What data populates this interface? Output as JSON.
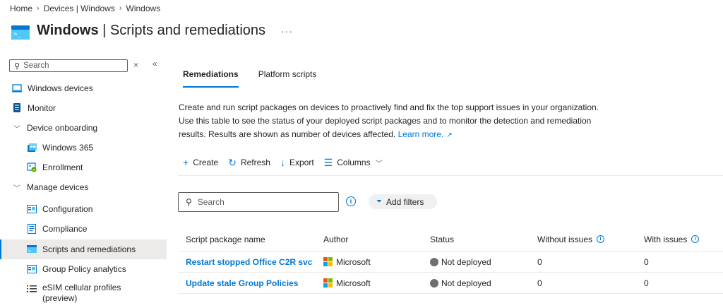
{
  "breadcrumb": [
    "Home",
    "Devices | Windows",
    "Windows"
  ],
  "header": {
    "title_bold": "Windows",
    "title_rest": " | Scripts and remediations",
    "more": "···"
  },
  "sidebar": {
    "search_placeholder": "Search",
    "close_glyph": "×",
    "collapse_glyph": "«",
    "items": [
      {
        "label": "Windows devices",
        "icon": "laptop-icon"
      },
      {
        "label": "Monitor",
        "icon": "monitor-icon"
      },
      {
        "label": "Device onboarding",
        "icon": "chevron-down-icon"
      },
      {
        "label": "Windows 365",
        "icon": "windows365-icon"
      },
      {
        "label": "Enrollment",
        "icon": "enrollment-icon"
      },
      {
        "label": "Manage devices",
        "icon": "chevron-down-icon"
      },
      {
        "label": "Configuration",
        "icon": "configuration-icon"
      },
      {
        "label": "Compliance",
        "icon": "compliance-icon"
      },
      {
        "label": "Scripts and remediations",
        "icon": "scripts-icon",
        "selected": true
      },
      {
        "label": "Group Policy analytics",
        "icon": "group-policy-icon"
      },
      {
        "label": "eSIM cellular profiles (preview)",
        "icon": "esim-icon"
      }
    ]
  },
  "tabs": [
    {
      "label": "Remediations",
      "active": true
    },
    {
      "label": "Platform scripts",
      "active": false
    }
  ],
  "description": {
    "text": "Create and run script packages on devices to proactively find and fix the top support issues in your organization. Use this table to see the status of your deployed script packages and to monitor the detection and remediation results. Results are shown as number of devices affected. ",
    "link": "Learn more."
  },
  "toolbar": {
    "create": "Create",
    "refresh": "Refresh",
    "export": "Export",
    "columns": "Columns"
  },
  "search": {
    "placeholder": "Search"
  },
  "filters": {
    "add_label": "Add filters"
  },
  "table": {
    "columns": [
      "Script package name",
      "Author",
      "Status",
      "Without issues",
      "With issues"
    ],
    "rows": [
      {
        "name": "Restart stopped Office C2R svc",
        "author": "Microsoft",
        "status": "Not deployed",
        "without": "0",
        "with": "0"
      },
      {
        "name": "Update stale Group Policies",
        "author": "Microsoft",
        "status": "Not deployed",
        "without": "0",
        "with": "0"
      }
    ]
  },
  "colors": {
    "accent": "#0078d4",
    "selected_bg": "#edebe9",
    "status_gray": "#6e6e6e",
    "ms_red": "#f25022",
    "ms_green": "#7fba00",
    "ms_blue": "#00a4ef",
    "ms_yellow": "#ffb900"
  }
}
